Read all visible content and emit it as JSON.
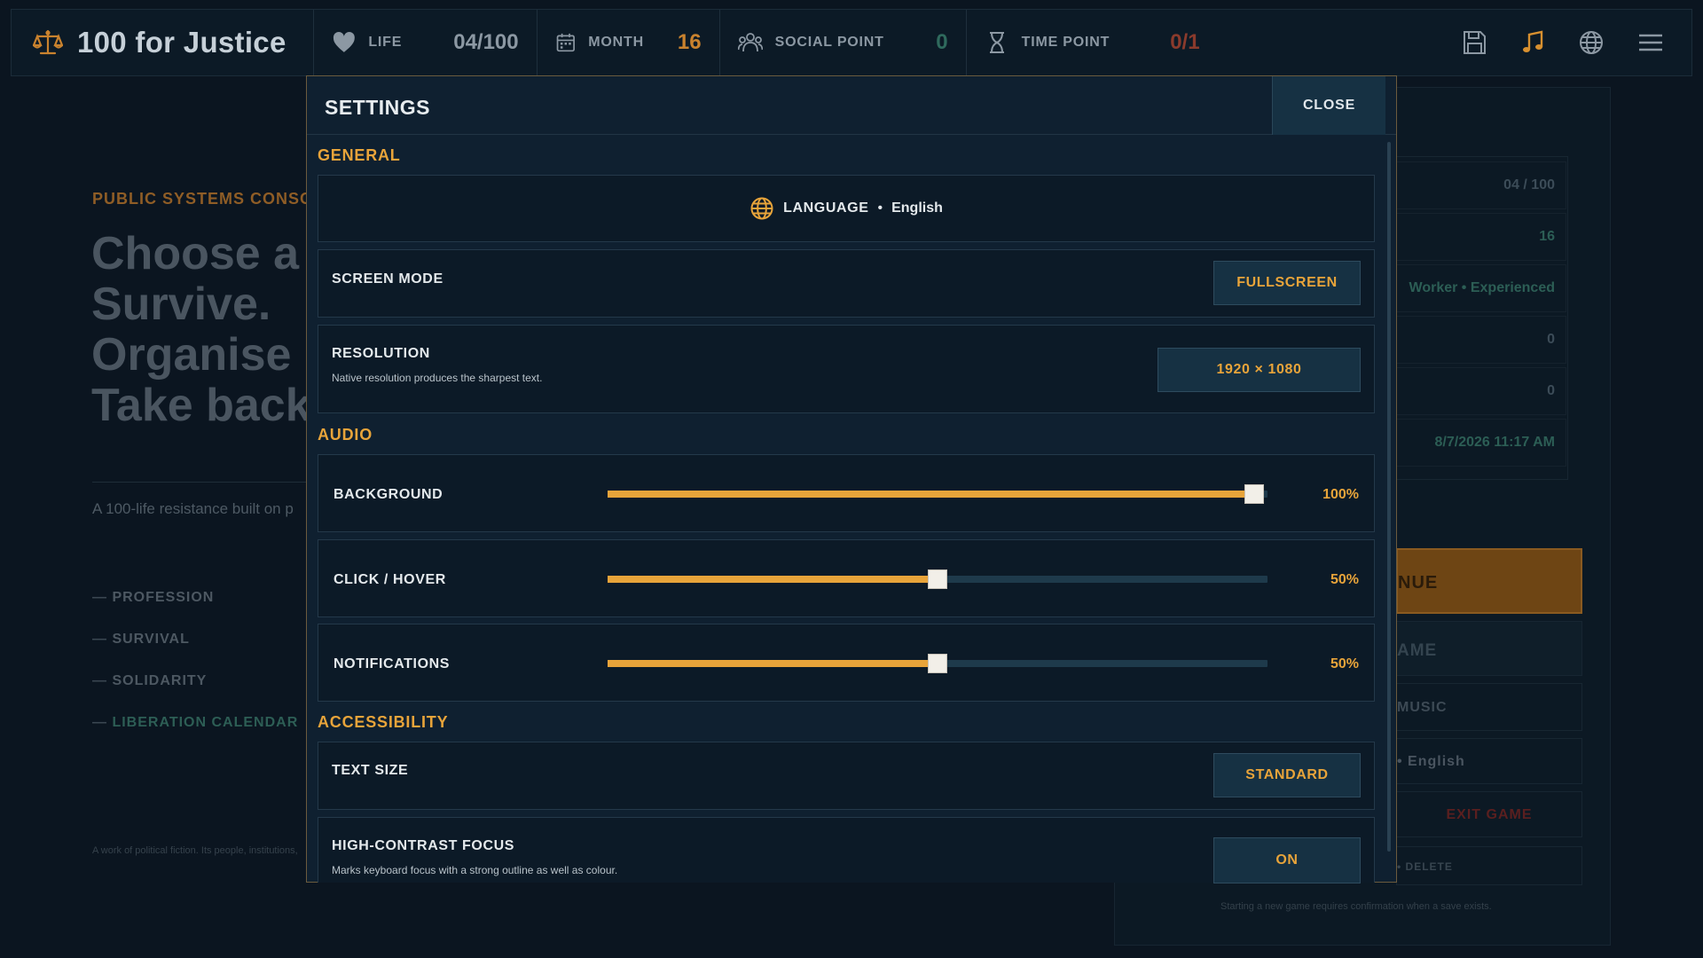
{
  "topbar": {
    "title": "100 for Justice",
    "life": {
      "label": "LIFE",
      "value": "04/100",
      "color": "#8c98a3"
    },
    "month": {
      "label": "MONTH",
      "value": "16",
      "color": "#c9822e"
    },
    "social": {
      "label": "SOCIAL POINT",
      "value": "0",
      "color": "#2f6a5d"
    },
    "time": {
      "label": "TIME POINT",
      "value": "0/1",
      "color": "#8a3a2c"
    },
    "icons": [
      "save-icon",
      "music-icon",
      "globe-icon",
      "menu-icon"
    ]
  },
  "background": {
    "eyebrow": "PUBLIC SYSTEMS CONSO",
    "headline": [
      "Choose a",
      "Survive.",
      "Organise",
      "Take back"
    ],
    "subtitle": "A 100-life resistance built on p",
    "nav": [
      "PROFESSION",
      "SURVIVAL",
      "SOLIDARITY",
      "LIBERATION CALENDAR"
    ],
    "footer": "A work of political fiction. Its people, institutions,",
    "stats": [
      "04 / 100",
      "16",
      "Worker • Experienced",
      "0",
      "0",
      "8/7/2026 11:17 AM"
    ],
    "buttons": {
      "continue": "NUE",
      "new_game": "AME",
      "music": "MUSIC",
      "language": "• English",
      "exit": "EXIT GAME",
      "delete": "• DELETE"
    },
    "note": "Starting a new game requires confirmation when a save exists."
  },
  "settings": {
    "title": "SETTINGS",
    "close": "CLOSE",
    "general": {
      "heading": "GENERAL",
      "language_label": "LANGUAGE",
      "language_value": "English",
      "screen_mode_label": "SCREEN MODE",
      "screen_mode_value": "FULLSCREEN",
      "resolution_label": "RESOLUTION",
      "resolution_desc": "Native resolution produces the sharpest text.",
      "resolution_value": "1920 × 1080"
    },
    "audio": {
      "heading": "AUDIO",
      "sliders": [
        {
          "label": "BACKGROUND",
          "value": 100,
          "display": "100%"
        },
        {
          "label": "CLICK / HOVER",
          "value": 50,
          "display": "50%"
        },
        {
          "label": "NOTIFICATIONS",
          "value": 50,
          "display": "50%"
        }
      ]
    },
    "accessibility": {
      "heading": "ACCESSIBILITY",
      "text_size_label": "TEXT SIZE",
      "text_size_value": "STANDARD",
      "contrast_label": "HIGH-CONTRAST FOCUS",
      "contrast_desc": "Marks keyboard focus with a strong outline as well as colour.",
      "contrast_value": "ON"
    }
  },
  "colors": {
    "accent": "#e8a43a",
    "panel": "#0f2030",
    "background": "#0b1520"
  }
}
